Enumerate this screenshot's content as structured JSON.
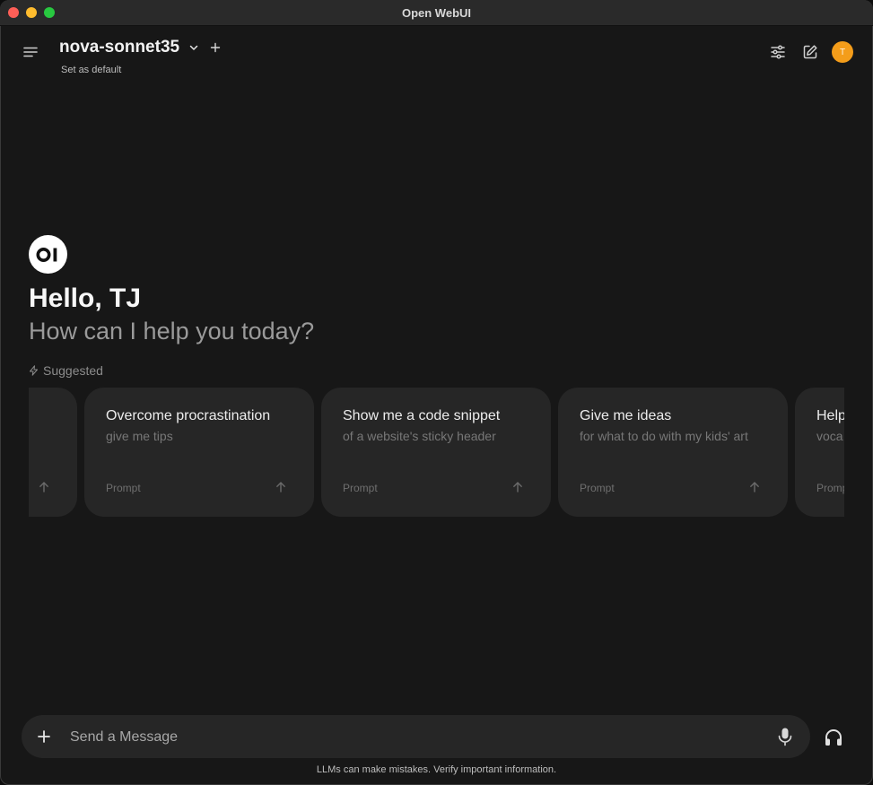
{
  "window": {
    "title": "Open WebUI"
  },
  "header": {
    "model_name": "nova-sonnet35",
    "set_default_label": "Set as default",
    "avatar_initial": "T"
  },
  "hero": {
    "logo_text": "OI",
    "greeting": "Hello, TJ",
    "subgreeting": "How can I help you today?",
    "suggested_label": "Suggested"
  },
  "suggestions": [
    {
      "title": "",
      "subtitle": "",
      "prompt_label": ""
    },
    {
      "title": "Overcome procrastination",
      "subtitle": "give me tips",
      "prompt_label": "Prompt"
    },
    {
      "title": "Show me a code snippet",
      "subtitle": "of a website's sticky header",
      "prompt_label": "Prompt"
    },
    {
      "title": "Give me ideas",
      "subtitle": "for what to do with my kids' art",
      "prompt_label": "Prompt"
    },
    {
      "title": "Help",
      "subtitle": "voca exam",
      "prompt_label": "Promp"
    }
  ],
  "composer": {
    "placeholder": "Send a Message",
    "disclaimer": "LLMs can make mistakes. Verify important information."
  },
  "colors": {
    "background": "#171717",
    "card": "#262626",
    "avatar": "#f49d1a"
  },
  "icons": {
    "menu": "hamburger-menu-icon",
    "model_dropdown": "chevron-down-icon",
    "add_model": "plus-icon",
    "controls": "sliders-icon",
    "new_chat": "pencil-square-icon",
    "suggested": "lightning-bolt-icon",
    "card_arrow": "arrow-up-icon",
    "attach": "plus-icon",
    "voice_input": "microphone-icon",
    "voice_mode": "headphones-icon"
  }
}
